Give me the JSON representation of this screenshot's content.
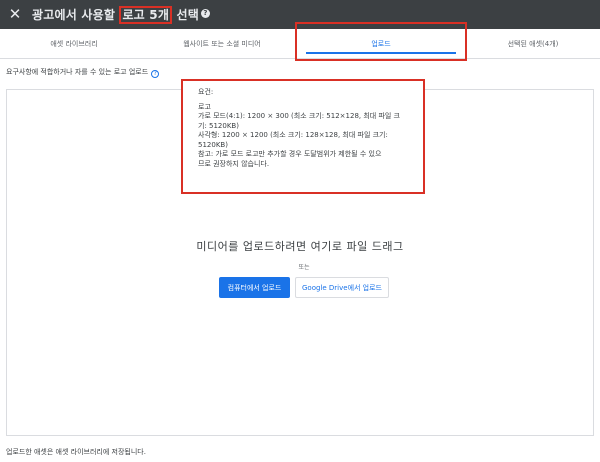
{
  "header": {
    "close_icon": "close-icon",
    "title_before": "광고에서 사용할 ",
    "title_highlight": "로고 5개",
    "title_after": " 선택",
    "help_glyph": "?"
  },
  "tabs": [
    {
      "label": "애셋 라이브러리",
      "active": false
    },
    {
      "label": "웹사이트 또는 소셜 미디어",
      "active": false
    },
    {
      "label": "업로드",
      "active": true
    },
    {
      "label": "선택된 애셋(4개)",
      "active": false
    }
  ],
  "requirements": {
    "text": "요구사항에 적합하거나 자를 수 있는 로고 업로드",
    "help_glyph": "?"
  },
  "tooltip": {
    "heading": "요건:",
    "logo_title": "로고",
    "landscape_line1": "가로 모드(4:1): 1200 × 300 (최소 크기: 512×128, 최대 파일 크",
    "landscape_line2": "기: 5120KB)",
    "square_line1": "사각형: 1200 × 1200 (최소 크기: 128×128, 최대 파일 크기:",
    "square_line2": "5120KB)",
    "note_line1": "참고: 가로 모드 로고만 추가할 경우 도달범위가 제한될 수 있으",
    "note_line2": "므로 권장하지 않습니다."
  },
  "dropzone": {
    "title": "미디어를 업로드하려면 여기로 파일 드래그",
    "or": "또는",
    "upload_computer": "컴퓨터에서 업로드",
    "upload_drive": "Google Drive에서 업로드"
  },
  "footer": {
    "text": "업로드한 애셋은 애셋 라이브러리에 저장됩니다."
  },
  "colors": {
    "header_bg": "#3c4043",
    "accent": "#1a73e8",
    "highlight_border": "#d93025"
  }
}
